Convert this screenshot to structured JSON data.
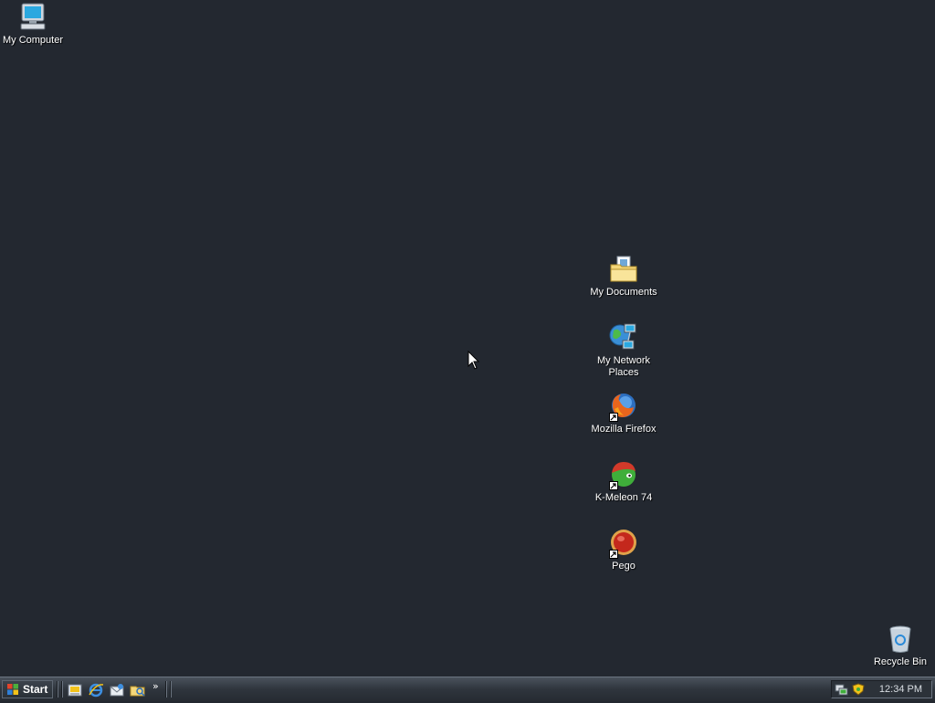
{
  "desktop": {
    "icons": {
      "my_computer": "My Computer",
      "my_documents": "My Documents",
      "my_network_places": "My Network Places",
      "mozilla_firefox": "Mozilla Firefox",
      "k_meleon": "K-Meleon 74",
      "pego": "Pego",
      "recycle_bin": "Recycle Bin"
    },
    "background_color": "#232830"
  },
  "taskbar": {
    "start_label": "Start",
    "quick_launch": [
      "show-desktop-icon",
      "internet-explorer-icon",
      "outlook-express-icon",
      "windows-explorer-icon"
    ],
    "chevron": "»",
    "tray_icons": [
      "network-connection-icon",
      "security-shield-icon"
    ],
    "clock": "12:34 PM"
  }
}
